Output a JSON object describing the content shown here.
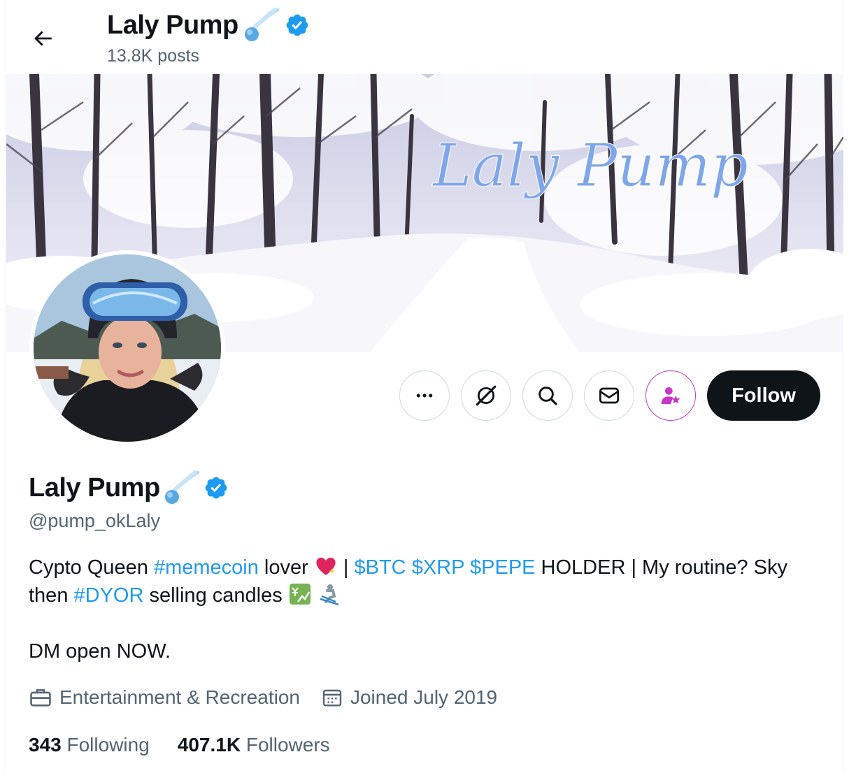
{
  "header": {
    "display_name": "Laly Pump",
    "post_count": "13.8K posts"
  },
  "banner": {
    "overlay_text": "Laly Pump"
  },
  "actions": {
    "follow_label": "Follow"
  },
  "profile": {
    "display_name": "Laly Pump",
    "handle": "@pump_okLaly",
    "bio": {
      "l1_a": "Cypto Queen ",
      "l1_tag1": "#memecoin",
      "l1_b": " lover ",
      "l1_c": " | ",
      "l1_cash1": "$BTC",
      "l1_cash2": "$XRP",
      "l1_cash3": "$PEPE",
      "l1_d": " HOLDER  | My routine? Sky",
      "l2_a": "then ",
      "l2_tag": "#DYOR",
      "l2_b": " selling candles ",
      "l3": "DM open NOW."
    },
    "category": "Entertainment & Recreation",
    "joined": "Joined July 2019",
    "following_count": "343",
    "following_label": "Following",
    "followers_count": "407.1K",
    "followers_label": "Followers"
  },
  "colors": {
    "link": "#1d9bf0",
    "verified": "#1d9bf0",
    "subscribe": "#c837c9",
    "text": "#0f1419",
    "muted": "#536471"
  },
  "icons": [
    "back-arrow-icon",
    "comet-emoji-icon",
    "verified-badge-icon",
    "more-icon",
    "grok-icon",
    "search-icon",
    "message-icon",
    "subscribe-icon",
    "sparkling-heart-emoji-icon",
    "chart-yen-emoji-icon",
    "skier-emoji-icon",
    "briefcase-icon",
    "calendar-icon"
  ]
}
